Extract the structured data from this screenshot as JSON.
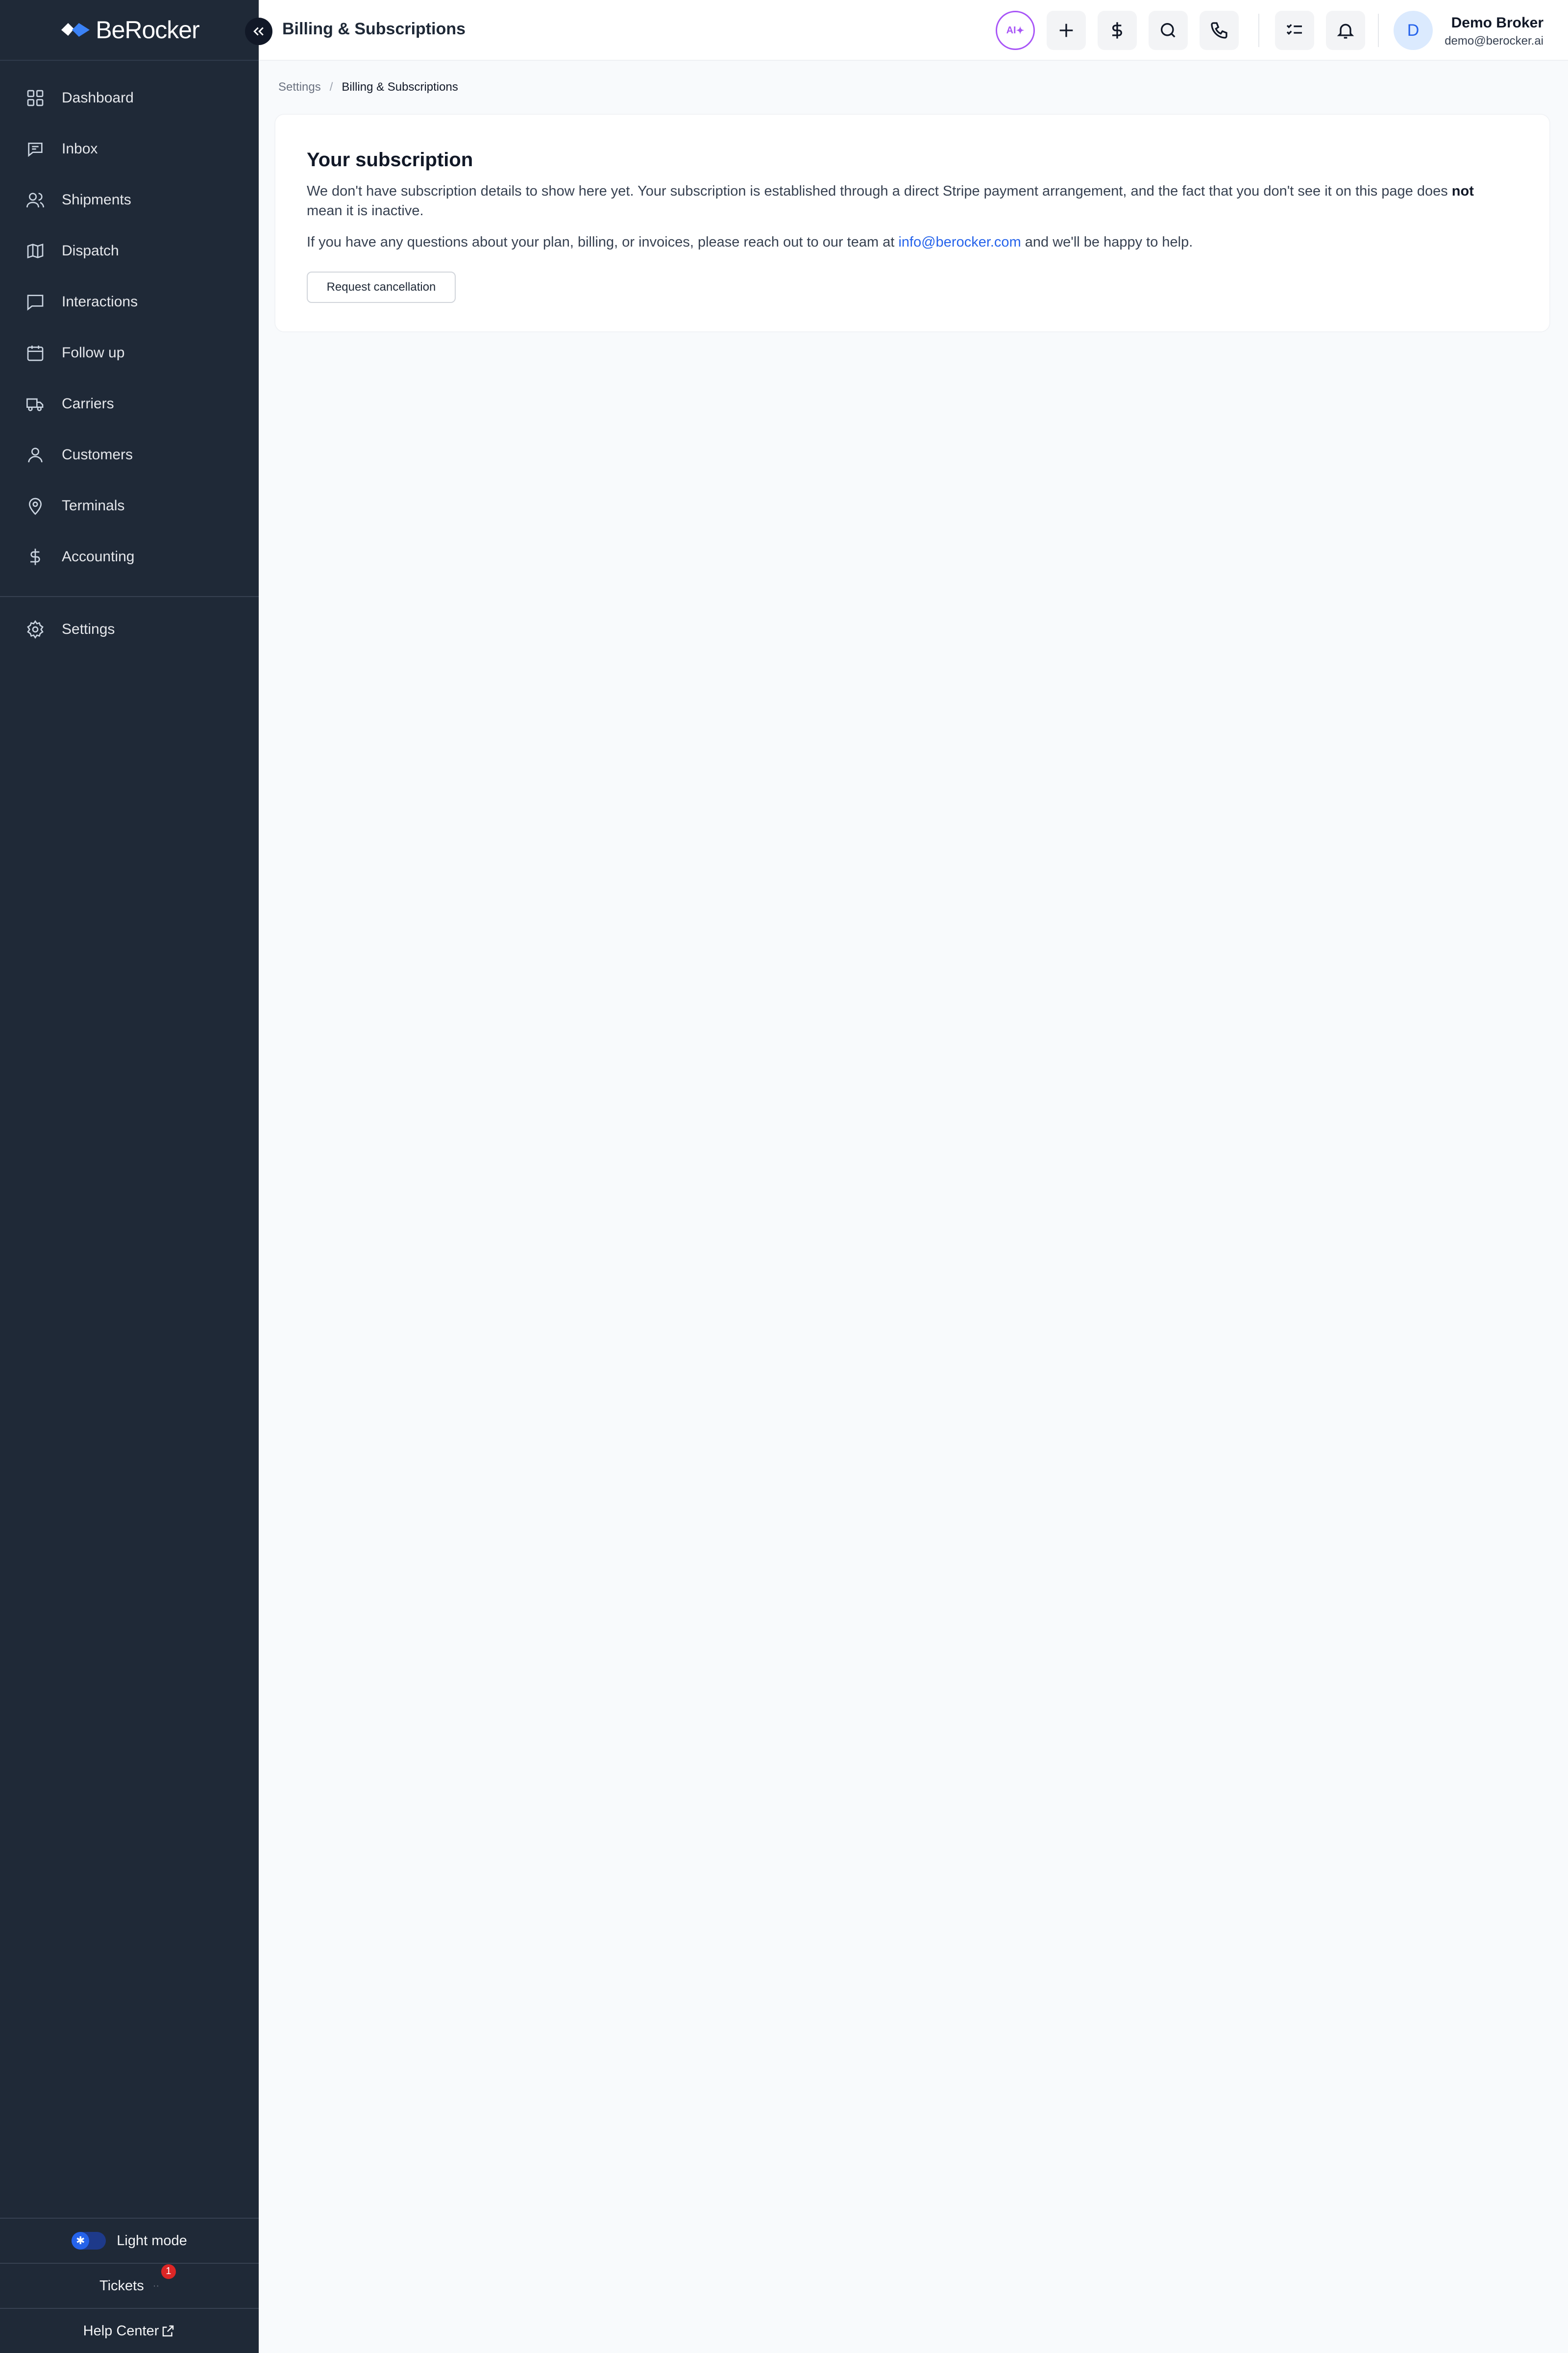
{
  "brand": {
    "name": "BeRocker"
  },
  "header": {
    "title": "Billing & Subscriptions",
    "ai_label": "AI",
    "user": {
      "initial": "D",
      "name": "Demo Broker",
      "email": "demo@berocker.ai"
    }
  },
  "sidebar": {
    "items": [
      {
        "label": "Dashboard",
        "icon": "grid-icon"
      },
      {
        "label": "Inbox",
        "icon": "message-icon"
      },
      {
        "label": "Shipments",
        "icon": "users-icon"
      },
      {
        "label": "Dispatch",
        "icon": "map-icon"
      },
      {
        "label": "Interactions",
        "icon": "chat-icon"
      },
      {
        "label": "Follow up",
        "icon": "calendar-icon"
      },
      {
        "label": "Carriers",
        "icon": "truck-icon"
      },
      {
        "label": "Customers",
        "icon": "user-icon"
      },
      {
        "label": "Terminals",
        "icon": "map-pin-icon"
      },
      {
        "label": "Accounting",
        "icon": "dollar-icon"
      },
      {
        "label": "Settings",
        "icon": "gear-icon"
      }
    ],
    "bottom": {
      "theme_label": "Light mode",
      "tickets_label": "Tickets",
      "tickets_count": "1",
      "help_label": "Help Center"
    }
  },
  "breadcrumb": {
    "parent": "Settings",
    "separator": "/",
    "current": "Billing & Subscriptions"
  },
  "subscription": {
    "title": "Your subscription",
    "p1_before": "We don't have subscription details to show here yet. Your subscription is established through a direct Stripe payment arrangement, and the fact that you don't see it on this page does ",
    "p1_bold": "not",
    "p1_after": " mean it is inactive.",
    "p2_before": "If you have any questions about your plan, billing, or invoices, please reach out to our team at ",
    "p2_link": "info@berocker.com",
    "p2_after": " and we'll be happy to help.",
    "cancel_label": "Request cancellation"
  },
  "colors": {
    "sidebar_bg": "#1f2937",
    "accent": "#2563eb",
    "ai_accent": "#a855f7",
    "badge": "#dc2626"
  }
}
